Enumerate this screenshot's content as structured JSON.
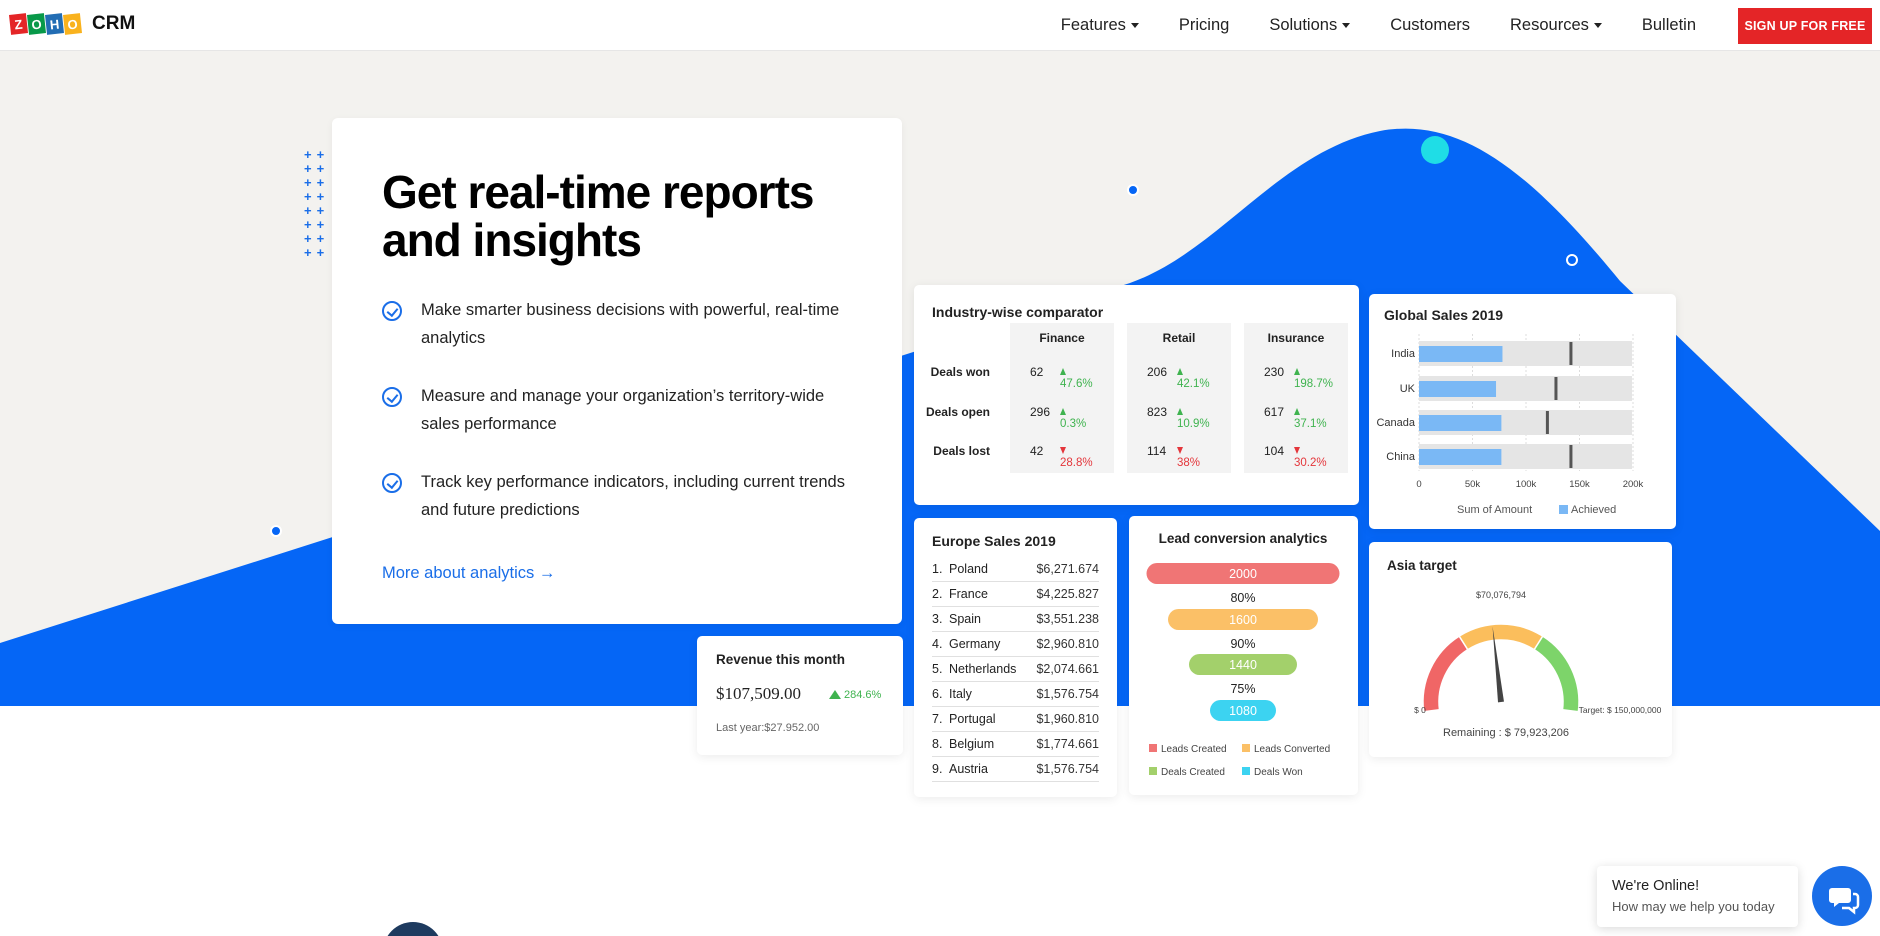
{
  "nav": {
    "logo_letters": [
      "Z",
      "O",
      "H",
      "O"
    ],
    "logo_colors": [
      "#e42527",
      "#089949",
      "#226db4",
      "#f9b21d"
    ],
    "product": "CRM",
    "links": [
      {
        "label": "Features",
        "dropdown": true
      },
      {
        "label": "Pricing",
        "dropdown": false
      },
      {
        "label": "Solutions",
        "dropdown": true
      },
      {
        "label": "Customers",
        "dropdown": false
      },
      {
        "label": "Resources",
        "dropdown": true
      },
      {
        "label": "Bulletin",
        "dropdown": false
      }
    ],
    "signup": "SIGN UP FOR FREE"
  },
  "colors": {
    "accent": "#1a6ee8",
    "signup": "#e42527",
    "hero_blue": "#0566f6",
    "up": "#3fb34f",
    "down": "#e4363b"
  },
  "hero": {
    "plus": "+",
    "title_line1": "Get real-time reports",
    "title_line2": "and insights",
    "bullets": [
      "Make smarter business decisions with powerful, real-time analytics",
      "Measure and manage your organization’s territory-wide sales performance",
      "Track key performance indicators, including current trends and future predictions"
    ],
    "link": "More about analytics",
    "link_arrow": "→"
  },
  "industry": {
    "title": "Industry-wise comparator",
    "columns": [
      "Finance",
      "Retail",
      "Insurance"
    ],
    "rows": [
      {
        "label": "Deals won",
        "cells": [
          {
            "value": "62",
            "change": "47.6%",
            "dir": "up"
          },
          {
            "value": "206",
            "change": "42.1%",
            "dir": "up"
          },
          {
            "value": "230",
            "change": "198.7%",
            "dir": "up"
          }
        ]
      },
      {
        "label": "Deals open",
        "cells": [
          {
            "value": "296",
            "change": "0.3%",
            "dir": "up"
          },
          {
            "value": "823",
            "change": "10.9%",
            "dir": "up"
          },
          {
            "value": "617",
            "change": "37.1%",
            "dir": "up"
          }
        ]
      },
      {
        "label": "Deals lost",
        "cells": [
          {
            "value": "42",
            "change": "28.8%",
            "dir": "down"
          },
          {
            "value": "114",
            "change": "38%",
            "dir": "down"
          },
          {
            "value": "104",
            "change": "30.2%",
            "dir": "down"
          }
        ]
      }
    ]
  },
  "global": {
    "title": "Global Sales 2019",
    "chart_data": {
      "type": "bar",
      "orientation": "horizontal",
      "categories": [
        "India",
        "UK",
        "Canada",
        "China"
      ],
      "achieved": [
        78000,
        72000,
        77000,
        77000
      ],
      "target_marker": [
        142000,
        128000,
        120000,
        142000
      ],
      "xlim": [
        0,
        200000
      ],
      "xticks": [
        "0",
        "50k",
        "100k",
        "150k",
        "200k"
      ],
      "legend": [
        "Sum of Amount",
        "Achieved"
      ],
      "bar_color": "#7ab8f5",
      "track_color": "#e5e5e5"
    }
  },
  "europe": {
    "title": "Europe Sales 2019",
    "rows": [
      {
        "rank": "1.",
        "country": "Poland",
        "value": "$6,271.674"
      },
      {
        "rank": "2.",
        "country": "France",
        "value": "$4,225.827"
      },
      {
        "rank": "3.",
        "country": "Spain",
        "value": "$3,551.238"
      },
      {
        "rank": "4.",
        "country": "Germany",
        "value": "$2,960.810"
      },
      {
        "rank": "5.",
        "country": "Netherlands",
        "value": "$2,074.661"
      },
      {
        "rank": "6.",
        "country": "Italy",
        "value": "$1,576.754"
      },
      {
        "rank": "7.",
        "country": "Portugal",
        "value": "$1,960.810"
      },
      {
        "rank": "8.",
        "country": "Belgium",
        "value": "$1,774.661"
      },
      {
        "rank": "9.",
        "country": "Austria",
        "value": "$1,576.754"
      }
    ]
  },
  "lead": {
    "title": "Lead conversion analytics",
    "chart_data": {
      "type": "bar",
      "categories": [
        "Leads Created",
        "Leads Converted",
        "Deals Created",
        "Deals Won"
      ],
      "values": [
        2000,
        1600,
        1440,
        1080
      ],
      "value_labels": [
        "2000",
        "1600",
        "1440",
        "1080"
      ],
      "conversion": [
        "80%",
        "90%",
        "75%"
      ],
      "colors": [
        "#f07575",
        "#fbc067",
        "#a3d06b",
        "#3cd3f1"
      ]
    }
  },
  "asia": {
    "title": "Asia target",
    "chart_data": {
      "type": "gauge",
      "min": 0,
      "max": 150000000,
      "value": 70076794,
      "value_label": "$70,076,794",
      "min_label": "$ 0",
      "max_label": "Target: $ 150,000,000",
      "remaining": "Remaining : $ 79,923,206",
      "colors": [
        "#f06666",
        "#fbbe5c",
        "#7dd46a"
      ]
    }
  },
  "revenue": {
    "title": "Revenue this month",
    "value": "$107,509.00",
    "change": "284.6%",
    "last_year": "Last year:$27.952.00"
  },
  "chat": {
    "status": "We're Online!",
    "prompt": "How may we help you today"
  }
}
